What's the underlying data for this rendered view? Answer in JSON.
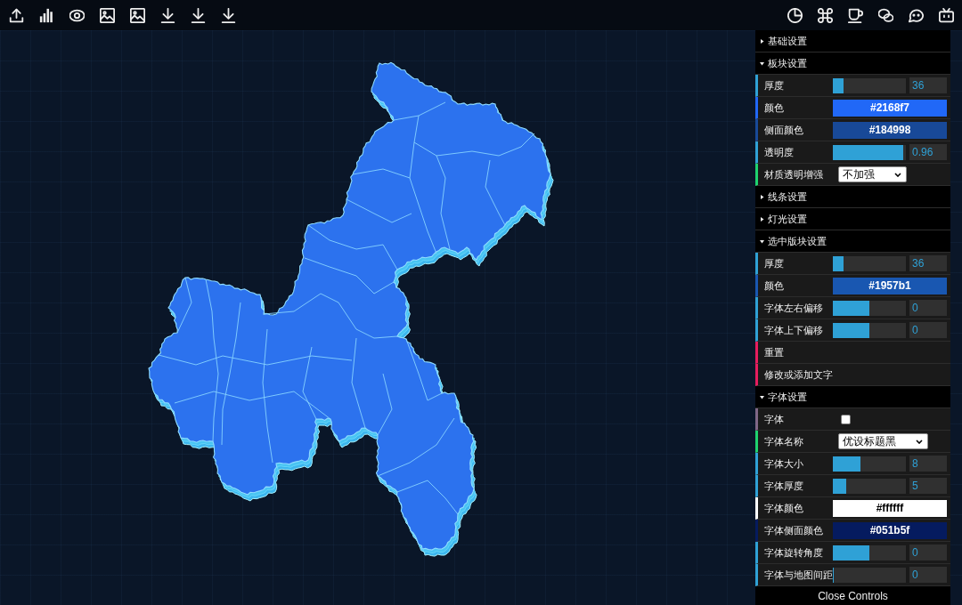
{
  "panel": {
    "folders": [
      {
        "title": "基础设置",
        "expanded": false
      },
      {
        "title": "板块设置",
        "expanded": true,
        "controls": [
          {
            "kind": "number",
            "label": "厚度",
            "level": 0.15,
            "value": "36"
          },
          {
            "kind": "color",
            "label": "颜色",
            "color": "#2168f7",
            "value": "#2168f7"
          },
          {
            "kind": "color",
            "label": "侧面颜色",
            "color": "#184998",
            "value": "#184998"
          },
          {
            "kind": "number",
            "label": "透明度",
            "level": 0.96,
            "value": "0.96"
          },
          {
            "kind": "select",
            "label": "材质透明增强",
            "value": "不加强"
          }
        ]
      },
      {
        "title": "线条设置",
        "expanded": false
      },
      {
        "title": "灯光设置",
        "expanded": false
      },
      {
        "title": "选中版块设置",
        "expanded": true,
        "controls": [
          {
            "kind": "number",
            "label": "厚度",
            "level": 0.15,
            "value": "36"
          },
          {
            "kind": "color",
            "label": "颜色",
            "color": "#1957b1",
            "value": "#1957b1"
          },
          {
            "kind": "number",
            "label": "字体左右偏移",
            "level": 0.5,
            "value": "0"
          },
          {
            "kind": "number",
            "label": "字体上下偏移",
            "level": 0.5,
            "value": "0"
          },
          {
            "kind": "function",
            "label": "重置"
          },
          {
            "kind": "function",
            "label": "修改或添加文字"
          }
        ]
      },
      {
        "title": "字体设置",
        "expanded": true,
        "controls": [
          {
            "kind": "boolean",
            "label": "字体",
            "checked": false
          },
          {
            "kind": "select",
            "label": "字体名称",
            "value": "优设标题黑"
          },
          {
            "kind": "number",
            "label": "字体大小",
            "level": 0.38,
            "value": "8"
          },
          {
            "kind": "number",
            "label": "字体厚度",
            "level": 0.18,
            "value": "5"
          },
          {
            "kind": "color",
            "label": "字体颜色",
            "color": "#ffffff",
            "value": "#ffffff"
          },
          {
            "kind": "color",
            "label": "字体侧面颜色",
            "color": "#051b5f",
            "value": "#051b5f"
          },
          {
            "kind": "number",
            "label": "字体旋转角度",
            "level": 0.5,
            "value": "0"
          },
          {
            "kind": "number",
            "label": "字体与地图间距",
            "level": 0,
            "value": "0"
          }
        ]
      }
    ],
    "close_button": "Close Controls"
  }
}
